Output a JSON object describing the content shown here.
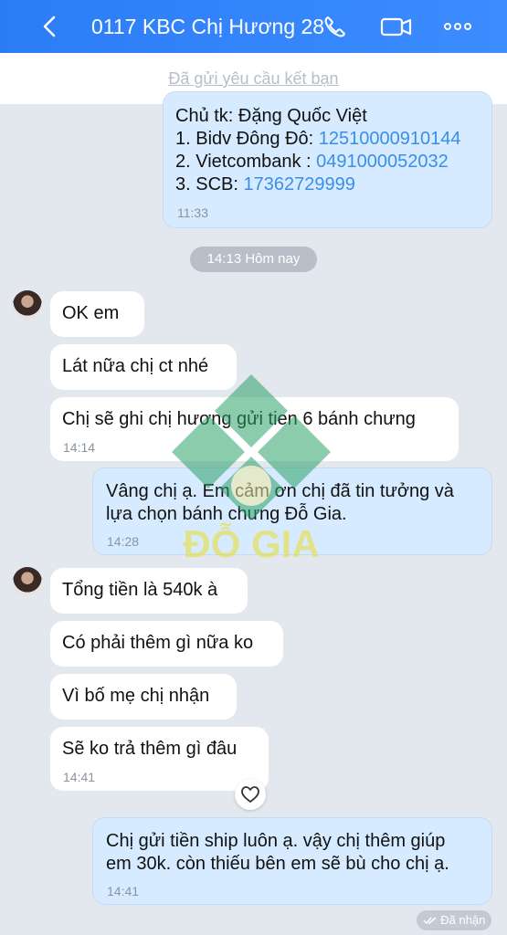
{
  "header": {
    "title": "0117 KBC Chị Hương 28",
    "accent": "#2b7df6"
  },
  "friend_request": {
    "label": "Đã gửi yêu cầu kết bạn"
  },
  "top_message": {
    "lines": [
      {
        "label": "Chủ tk: Đặng Quốc Việt",
        "value": ""
      },
      {
        "label": "1. Bidv Đông Đô: ",
        "value": "12510000910144"
      },
      {
        "label": "2. Vietcombank : ",
        "value": "0491000052032"
      },
      {
        "label": "3. SCB: ",
        "value": "17362729999"
      }
    ],
    "time": "11:33"
  },
  "date_separator": "14:13 Hôm nay",
  "messages": [
    {
      "text": "OK em"
    },
    {
      "text": "Lát nữa chị ct nhé"
    },
    {
      "text": "Chị sẽ ghi chị hương gửi tien 6 bánh chưng",
      "time": "14:14"
    },
    {
      "lines": [
        "Vâng chị ạ. Em cảm ơn chị đã tin tưởng và",
        "lựa chọn bánh chưng Đỗ Gia."
      ],
      "time": "14:28"
    },
    {
      "text": "Tổng tiền là 540k à"
    },
    {
      "text": "Có phải thêm gì nữa  ko"
    },
    {
      "text": "Vì bố mẹ chị nhận"
    },
    {
      "text": "Sẽ ko trả thêm gì đâu",
      "time": "14:41"
    },
    {
      "lines": [
        "Chị gửi tiền ship luôn ạ. vậy chị thêm giúp",
        "em 30k. còn thiếu bên em sẽ bù cho chị ạ."
      ],
      "time": "14:41"
    }
  ],
  "status": {
    "received": "Đã nhận"
  },
  "watermark": {
    "text": "ĐỖ GIA"
  },
  "icons": [
    "back-icon",
    "phone-icon",
    "video-icon",
    "more-icon",
    "heart-icon",
    "double-check-icon"
  ]
}
